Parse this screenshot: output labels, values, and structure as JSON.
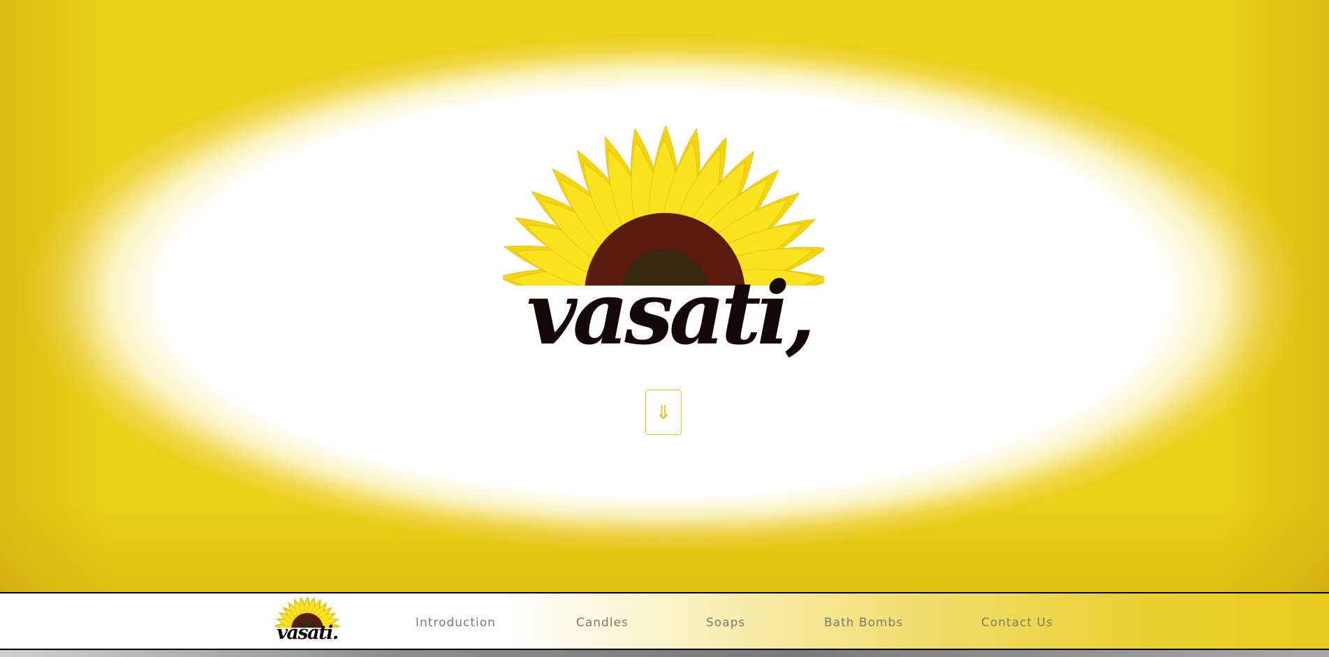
{
  "hero": {
    "logo_word": "vasati,",
    "scroll_button_symbol": "⇓",
    "logo_icon": "sunflower-icon"
  },
  "navbar": {
    "logo_word": "vasati.",
    "logo_icon": "sunflower-icon",
    "links": [
      {
        "label": "Introduction"
      },
      {
        "label": "Candles"
      },
      {
        "label": "Soaps"
      },
      {
        "label": "Bath Bombs"
      },
      {
        "label": "Contact Us"
      }
    ]
  },
  "colors": {
    "accent_yellow": "#e8c51c",
    "wordmark": "#140707",
    "nav_text": "#7d7a6a"
  }
}
